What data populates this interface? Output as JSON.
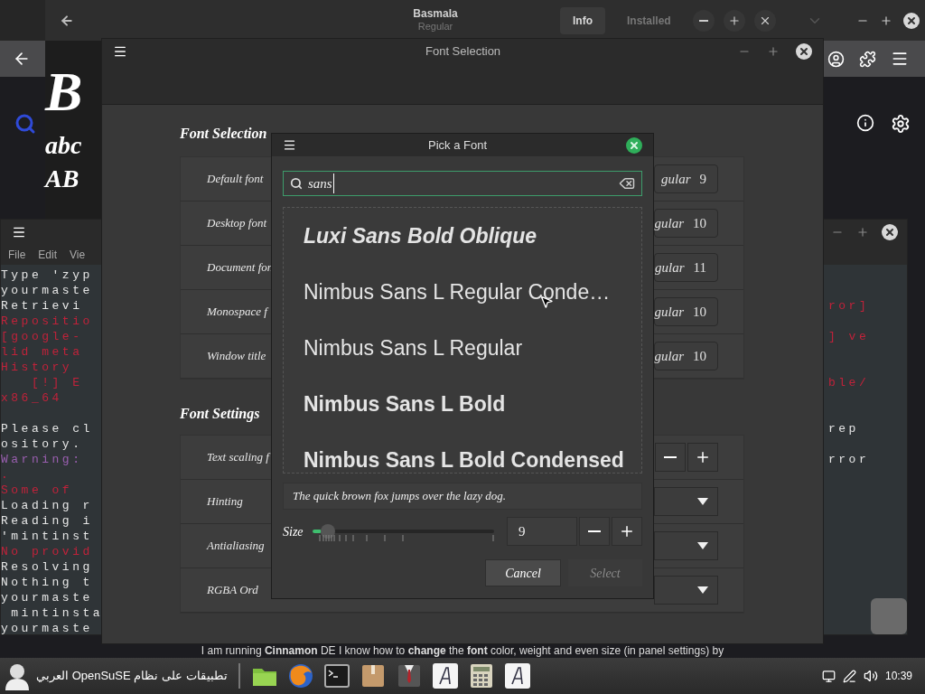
{
  "font_viewer": {
    "title": "Basmala",
    "subtitle": "Regular",
    "tabs": [
      {
        "label": "Info",
        "selected": true
      },
      {
        "label": "Installed",
        "selected": false
      }
    ],
    "preview_lines": [
      "B",
      "abc",
      "AB"
    ]
  },
  "terminal": {
    "menu": [
      "File",
      "Edit",
      "Vie"
    ],
    "lines": [
      {
        "kind": "normal",
        "text": "Type 'zyp"
      },
      {
        "kind": "normal",
        "text": "yourmaste"
      },
      {
        "kind": "normal",
        "text": "Retrievi",
        "right": {
          "kind": "error",
          "text": "ror]"
        }
      },
      {
        "kind": "error",
        "text": "Repositio"
      },
      {
        "kind": "error",
        "text": "[google-",
        "right": {
          "kind": "error",
          "text": "] ve"
        }
      },
      {
        "kind": "error",
        "text": "lid meta"
      },
      {
        "kind": "error",
        "text": "History"
      },
      {
        "kind": "error",
        "text": "   [!] E",
        "right": {
          "kind": "error",
          "text": "ble/"
        }
      },
      {
        "kind": "error",
        "text": "x86_64"
      },
      {
        "kind": "blank"
      },
      {
        "kind": "normal",
        "text": "Please cl",
        "right": {
          "kind": "normal",
          "text": "rep"
        }
      },
      {
        "kind": "normal",
        "text": "ository."
      },
      {
        "kind": "warning",
        "text": "Warning:",
        "right": {
          "kind": "normal",
          "text": "rror"
        }
      },
      {
        "kind": "error",
        "text": "."
      },
      {
        "kind": "error",
        "text": "Some of"
      },
      {
        "kind": "normal",
        "text": "Loading r"
      },
      {
        "kind": "normal",
        "text": "Reading i"
      },
      {
        "kind": "normal",
        "text": "'mintinst"
      },
      {
        "kind": "error",
        "text": "No provid"
      },
      {
        "kind": "normal",
        "text": "Resolving"
      },
      {
        "kind": "normal",
        "text": "Nothing t"
      },
      {
        "kind": "normal",
        "text": "yourmaste"
      },
      {
        "kind": "normal",
        "text": " mintinsta"
      },
      {
        "kind": "normal",
        "text": "yourmaste"
      }
    ]
  },
  "font_selection": {
    "title": "Font Selection",
    "sections": [
      {
        "heading": "Font Selection",
        "rows": [
          {
            "kind": "font",
            "label": "Default font",
            "value": "gular",
            "size": "9"
          },
          {
            "kind": "font",
            "label": "Desktop font",
            "value": "gular",
            "size": "10"
          },
          {
            "kind": "font",
            "label": "Document fon",
            "value": "gular",
            "size": "11"
          },
          {
            "kind": "font",
            "label": "Monospace f",
            "value": "gular",
            "size": "10"
          },
          {
            "kind": "font",
            "label": "Window title",
            "value": "gular",
            "size": "10"
          }
        ]
      },
      {
        "heading": "Font Settings",
        "rows": [
          {
            "kind": "spin",
            "label": "Text scaling f"
          },
          {
            "kind": "dropdown",
            "label": "Hinting"
          },
          {
            "kind": "dropdown",
            "label": "Antialiasing"
          },
          {
            "kind": "dropdown",
            "label": "RGBA Ord"
          }
        ]
      }
    ]
  },
  "web_text": "I am running **Cinnamon** DE I know how to **change** the **font** color, weight and even size (in panel settings) by",
  "dialog": {
    "title": "Pick a Font",
    "search": {
      "value": "sans"
    },
    "fonts": [
      {
        "name": "Luxi Sans Bold Oblique",
        "kind": "bolditalic"
      },
      {
        "name": "Nimbus Sans L Regular Conde…",
        "kind": "regular"
      },
      {
        "name": "Nimbus Sans L Regular",
        "kind": "regular"
      },
      {
        "name": "Nimbus Sans L Bold",
        "kind": "bold"
      },
      {
        "name": "Nimbus Sans L Bold Condensed",
        "kind": "bold"
      }
    ],
    "preview": "The quick brown fox jumps over the lazy dog.",
    "size_label": "Size",
    "size": {
      "level": 0.05,
      "value": "9"
    },
    "buttons": [
      {
        "label": "Cancel",
        "disabled": false
      },
      {
        "label": "Select",
        "disabled": true
      }
    ]
  },
  "taskbar": {
    "menu_label": "تطبيقات على نظام OpenSuSE العربي",
    "clock": "10:39"
  }
}
